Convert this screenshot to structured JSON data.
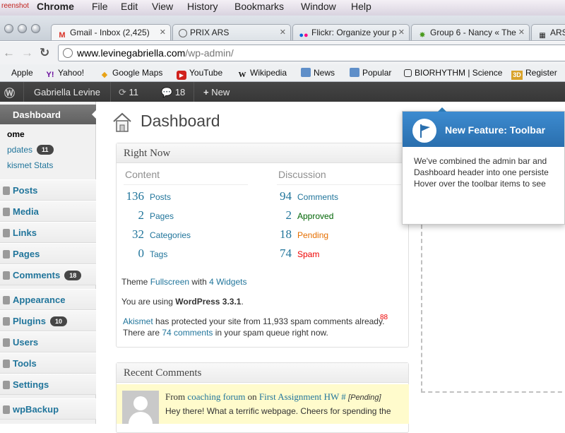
{
  "mac_menu": {
    "partial": "reenshot",
    "app": "Chrome",
    "items": [
      "File",
      "Edit",
      "View",
      "History",
      "Bookmarks",
      "Window",
      "Help"
    ]
  },
  "tabs": [
    {
      "label": "Gmail - Inbox (2,425)",
      "icon": "gmail-icon",
      "active": true
    },
    {
      "label": "PRIX ARS",
      "icon": "globe-icon"
    },
    {
      "label": "Flickr: Organize your p",
      "icon": "flickr-icon"
    },
    {
      "label": "Group 6 - Nancy « The",
      "icon": "green-star-icon"
    },
    {
      "label": "ARS",
      "icon": "qr-icon"
    }
  ],
  "address": {
    "host": "www.levinegabriella.com",
    "path": "/wp-admin/"
  },
  "bookmarks": [
    {
      "label": "Apple",
      "icon": "apple-icon"
    },
    {
      "label": "Yahoo!",
      "icon": "yahoo-icon"
    },
    {
      "label": "Google Maps",
      "icon": "maps-icon"
    },
    {
      "label": "YouTube",
      "icon": "youtube-icon"
    },
    {
      "label": "Wikipedia",
      "icon": "wikipedia-icon"
    },
    {
      "label": "News",
      "icon": "folder-icon"
    },
    {
      "label": "Popular",
      "icon": "folder-icon"
    },
    {
      "label": "BIORHYTHM | Science",
      "icon": "page-icon"
    },
    {
      "label": "Register",
      "icon": "3d-icon"
    }
  ],
  "wp_toolbar": {
    "user": "Gabriella Levine",
    "updates_count": "11",
    "comments_count": "18",
    "new_label": "New"
  },
  "sidebar": {
    "dashboard": "Dashboard",
    "subitems": [
      {
        "label": "ome",
        "badge": ""
      },
      {
        "label": "pdates",
        "badge": "11"
      },
      {
        "label": "kismet Stats",
        "badge": ""
      }
    ],
    "items": [
      {
        "label": "Posts",
        "badge": ""
      },
      {
        "label": "Media",
        "badge": ""
      },
      {
        "label": "Links",
        "badge": ""
      },
      {
        "label": "Pages",
        "badge": ""
      },
      {
        "label": "Comments",
        "badge": "18"
      },
      {
        "label": "Appearance",
        "badge": ""
      },
      {
        "label": "Plugins",
        "badge": "10"
      },
      {
        "label": "Users",
        "badge": ""
      },
      {
        "label": "Tools",
        "badge": ""
      },
      {
        "label": "Settings",
        "badge": ""
      },
      {
        "label": "wpBackup",
        "badge": ""
      }
    ]
  },
  "page_title": "Dashboard",
  "right_now": {
    "title": "Right Now",
    "content_heading": "Content",
    "discussion_heading": "Discussion",
    "content": [
      {
        "n": "136",
        "label": "Posts"
      },
      {
        "n": "2",
        "label": "Pages"
      },
      {
        "n": "32",
        "label": "Categories"
      },
      {
        "n": "0",
        "label": "Tags"
      }
    ],
    "discussion": [
      {
        "n": "94",
        "label": "Comments"
      },
      {
        "n": "2",
        "label": "Approved"
      },
      {
        "n": "18",
        "label": "Pending"
      },
      {
        "n": "74",
        "label": "Spam"
      }
    ],
    "theme_prefix": "Theme",
    "theme_name": "Fullscreen",
    "theme_with": "with",
    "widgets": "4 Widgets",
    "version_prefix": "You are using",
    "version": "WordPress 3.3.1",
    "version_suffix": ".",
    "akismet_link": "Akismet",
    "akismet_text": "has protected your site from 11,933 spam comments already.",
    "spam_count_badge": "88",
    "queue_prefix": "There are",
    "queue_link": "74 comments",
    "queue_suffix": "in your spam queue right now."
  },
  "recent_comments": {
    "title": "Recent Comments",
    "from": "From",
    "author": "coaching forum",
    "on": "on",
    "post": "First Assignment HW",
    "hash": "#",
    "status": "[Pending]",
    "excerpt": "Hey there! What a terrific webpage. Cheers for spending the"
  },
  "pointer": {
    "title": "New Feature: Toolbar",
    "body_lines": [
      "We've combined the admin bar and",
      "Dashboard header into one persiste",
      "Hover over the toolbar items to see"
    ]
  },
  "colors": {
    "link": "#21759b",
    "toolbar_bg": "#464646",
    "pointer_header": "#2a6fae",
    "pending": "#e66f00",
    "spam": "#e00000",
    "approved": "#006505"
  }
}
